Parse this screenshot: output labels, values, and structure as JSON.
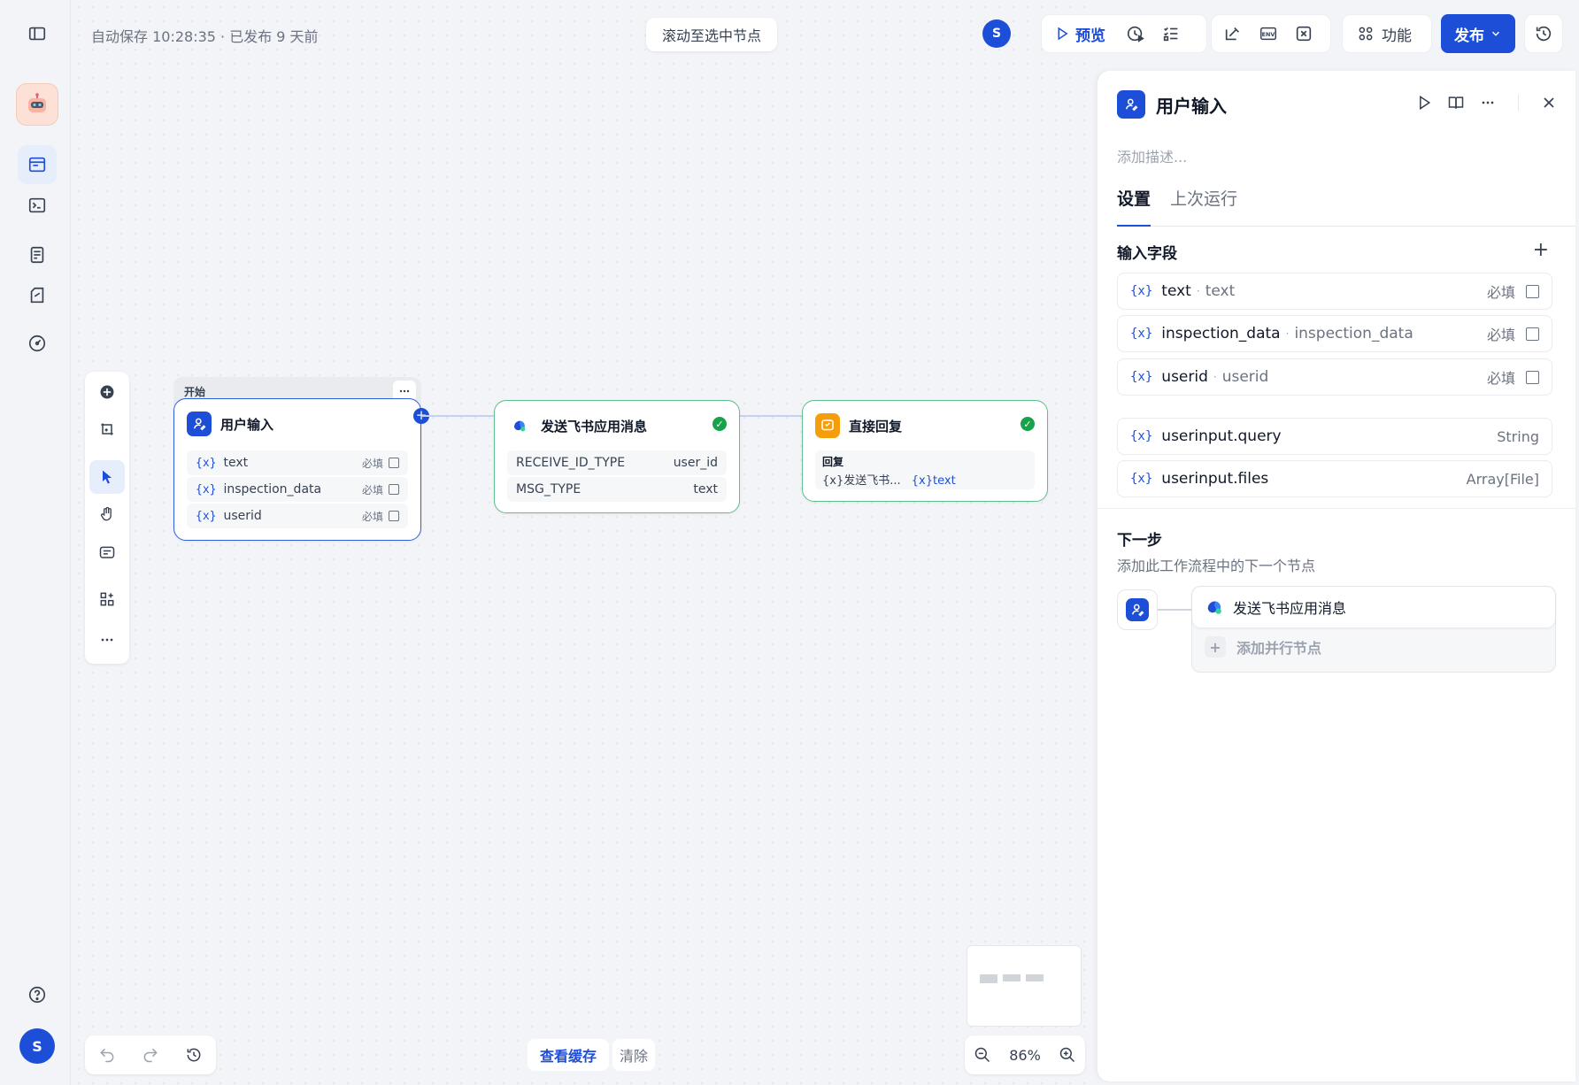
{
  "colors": {
    "accent": "#1d4ed8",
    "success": "#16a34a",
    "orange": "#f59e0b"
  },
  "header": {
    "autosave": "自动保存 10:28:35 · 已发布 9 天前",
    "scroll_to_selected": "滚动至选中节点",
    "avatar_letter": "S",
    "preview": "预览",
    "feature": "功能",
    "publish": "发布"
  },
  "sidebar": {
    "user_letter": "S"
  },
  "nodes": {
    "start": {
      "group_label": "开始",
      "title": "用户输入",
      "fields": [
        {
          "var": "{x}",
          "name": "text",
          "required": "必填"
        },
        {
          "var": "{x}",
          "name": "inspection_data",
          "required": "必填"
        },
        {
          "var": "{x}",
          "name": "userid",
          "required": "必填"
        }
      ]
    },
    "feishu": {
      "title": "发送飞书应用消息",
      "rows": [
        {
          "key": "RECEIVE_ID_TYPE",
          "value": "user_id"
        },
        {
          "key": "MSG_TYPE",
          "value": "text"
        }
      ]
    },
    "reply": {
      "title": "直接回复",
      "label": "回复",
      "var1": "{x}发送飞书...",
      "var2": "{x}text"
    }
  },
  "bottom": {
    "view_cache": "查看缓存",
    "clear": "清除",
    "zoom": "86%"
  },
  "panel": {
    "title": "用户输入",
    "description_placeholder": "添加描述...",
    "tabs": [
      "设置",
      "上次运行"
    ],
    "input_fields_title": "输入字段",
    "input_fields": [
      {
        "var": "{x}",
        "name": "text",
        "label": "text",
        "required": "必填"
      },
      {
        "var": "{x}",
        "name": "inspection_data",
        "label": "inspection_data",
        "required": "必填"
      },
      {
        "var": "{x}",
        "name": "userid",
        "label": "userid",
        "required": "必填"
      }
    ],
    "system_fields": [
      {
        "var": "{x}",
        "name": "userinput.query",
        "type": "String"
      },
      {
        "var": "{x}",
        "name": "userinput.files",
        "type": "Array[File]"
      }
    ],
    "next_title": "下一步",
    "next_subtitle": "添加此工作流程中的下一个节点",
    "next_node": "发送飞书应用消息",
    "add_parallel": "添加并行节点"
  }
}
